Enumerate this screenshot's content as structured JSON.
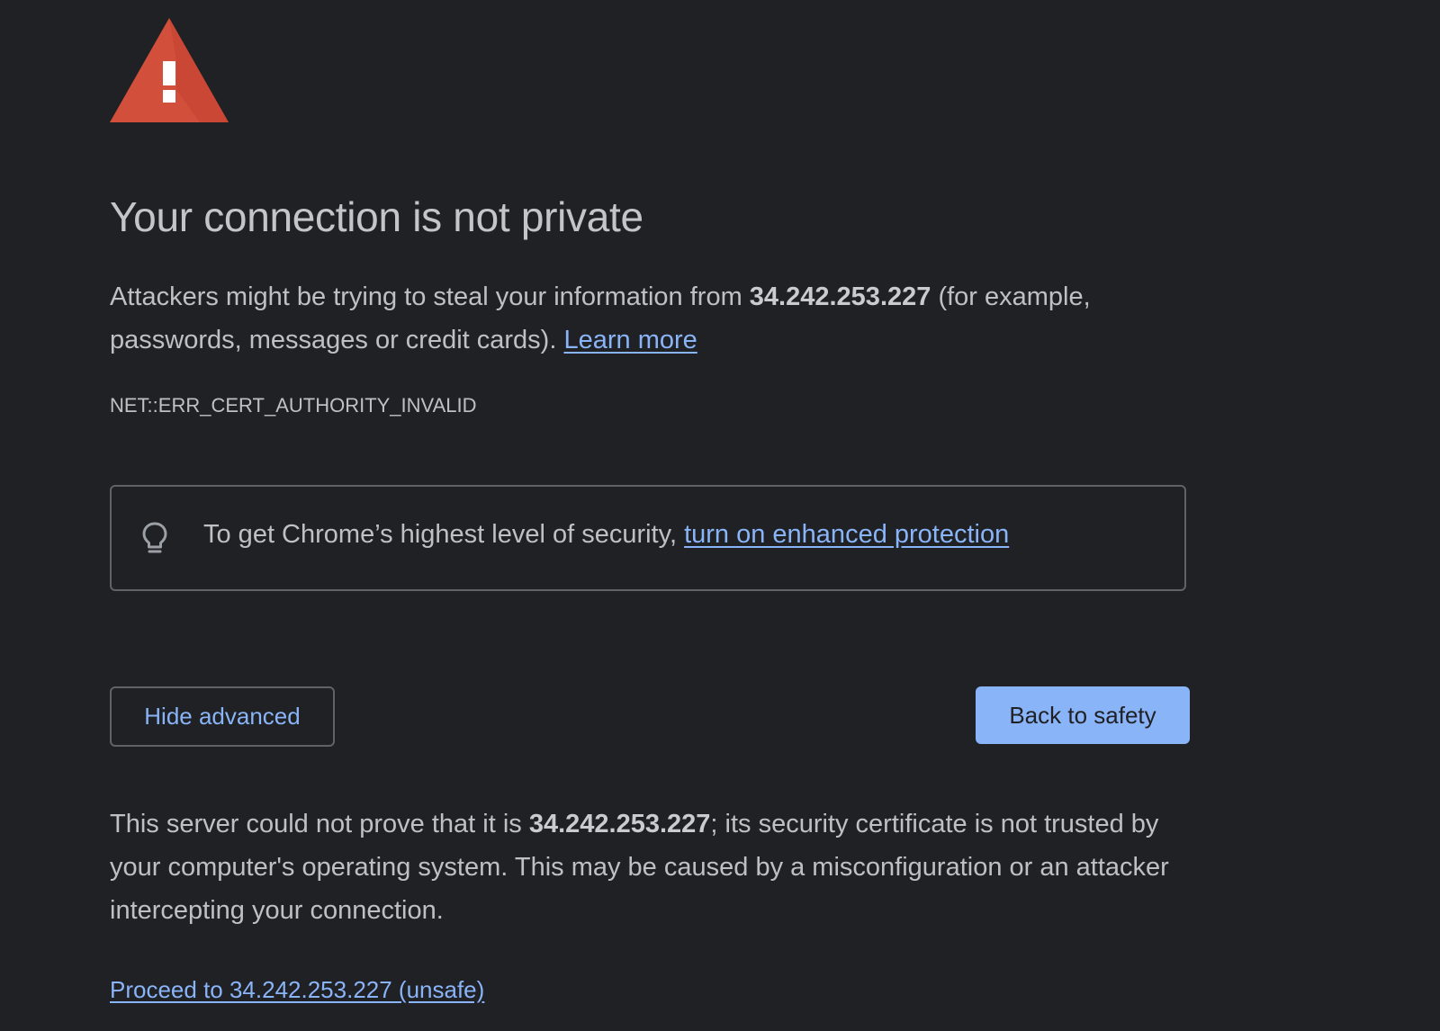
{
  "icons": {
    "warning": "warning-triangle-icon",
    "bulb": "lightbulb-icon"
  },
  "colors": {
    "background": "#202124",
    "text": "#bdc1c6",
    "link": "#8ab4f8",
    "warning_red": "#d24f3c",
    "primary_button": "#8ab4f8"
  },
  "main": {
    "title": "Your connection is not private",
    "intro": {
      "prefix": "Attackers might be trying to steal your information from ",
      "host": "34.242.253.227",
      "suffix": " (for example, passwords, messages or credit cards). ",
      "learn_more": "Learn more"
    },
    "error_code": "NET::ERR_CERT_AUTHORITY_INVALID",
    "promo": {
      "text": "To get Chrome’s highest level of security, ",
      "link": "turn on enhanced protection"
    },
    "buttons": {
      "hide_advanced": "Hide advanced",
      "back_to_safety": "Back to safety"
    },
    "details": {
      "prefix": "This server could not prove that it is ",
      "host": "34.242.253.227",
      "suffix": "; its security certificate is not trusted by your computer's operating system. This may be caused by a misconfiguration or an attacker intercepting your connection."
    },
    "proceed_link": "Proceed to 34.242.253.227 (unsafe)"
  }
}
